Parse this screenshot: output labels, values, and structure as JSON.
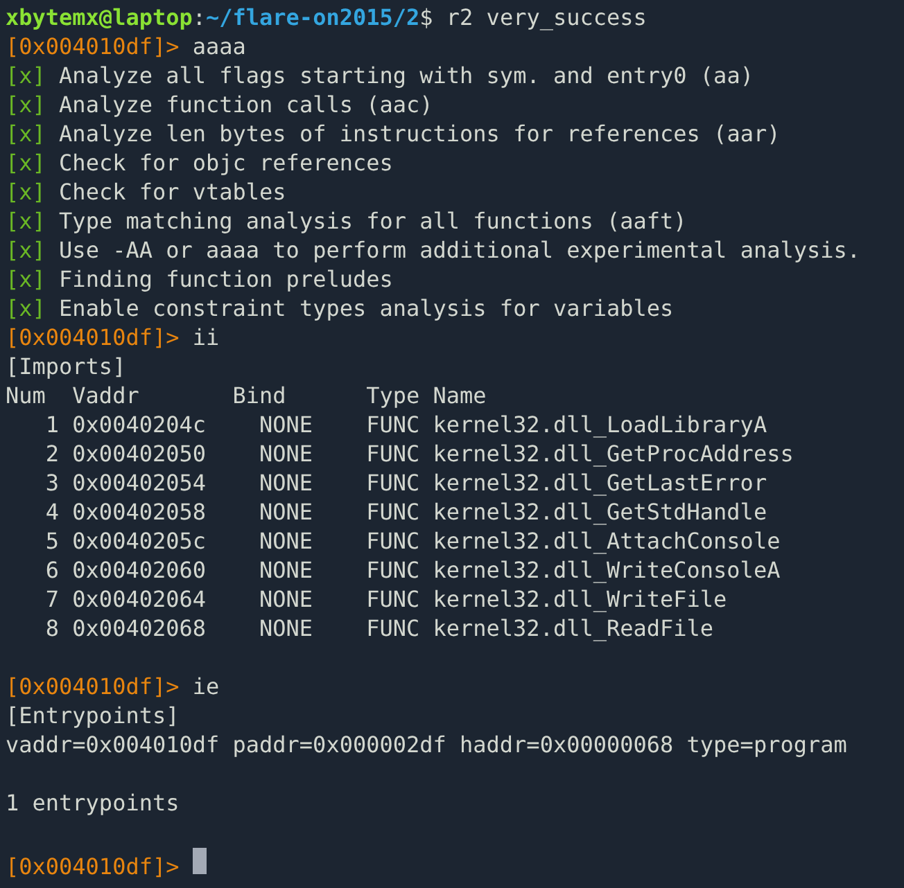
{
  "terminal": {
    "lines": [
      {
        "kind": "shell-prompt",
        "user_host": "xbytemx@laptop",
        "separator": ":",
        "path": "~/flare-on2015/2",
        "symbol": "$",
        "command": "r2 very_success"
      },
      {
        "kind": "r2-prompt",
        "address": "[0x004010df]>",
        "command": "aaaa"
      },
      {
        "kind": "check",
        "mark": "[x]",
        "text": "Analyze all flags starting with sym. and entry0 (aa)"
      },
      {
        "kind": "check",
        "mark": "[x]",
        "text": "Analyze function calls (aac)"
      },
      {
        "kind": "check",
        "mark": "[x]",
        "text": "Analyze len bytes of instructions for references (aar)"
      },
      {
        "kind": "check",
        "mark": "[x]",
        "text": "Check for objc references"
      },
      {
        "kind": "check",
        "mark": "[x]",
        "text": "Check for vtables"
      },
      {
        "kind": "check",
        "mark": "[x]",
        "text": "Type matching analysis for all functions (aaft)"
      },
      {
        "kind": "check",
        "mark": "[x]",
        "text": "Use -AA or aaaa to perform additional experimental analysis."
      },
      {
        "kind": "check",
        "mark": "[x]",
        "text": "Finding function preludes"
      },
      {
        "kind": "check",
        "mark": "[x]",
        "text": "Enable constraint types analysis for variables"
      },
      {
        "kind": "r2-prompt",
        "address": "[0x004010df]>",
        "command": "ii"
      },
      {
        "kind": "output",
        "text": "[Imports]"
      },
      {
        "kind": "output",
        "text": "Num  Vaddr       Bind      Type Name"
      },
      {
        "kind": "output",
        "text": "   1 0x0040204c    NONE    FUNC kernel32.dll_LoadLibraryA"
      },
      {
        "kind": "output",
        "text": "   2 0x00402050    NONE    FUNC kernel32.dll_GetProcAddress"
      },
      {
        "kind": "output",
        "text": "   3 0x00402054    NONE    FUNC kernel32.dll_GetLastError"
      },
      {
        "kind": "output",
        "text": "   4 0x00402058    NONE    FUNC kernel32.dll_GetStdHandle"
      },
      {
        "kind": "output",
        "text": "   5 0x0040205c    NONE    FUNC kernel32.dll_AttachConsole"
      },
      {
        "kind": "output",
        "text": "   6 0x00402060    NONE    FUNC kernel32.dll_WriteConsoleA"
      },
      {
        "kind": "output",
        "text": "   7 0x00402064    NONE    FUNC kernel32.dll_WriteFile"
      },
      {
        "kind": "output",
        "text": "   8 0x00402068    NONE    FUNC kernel32.dll_ReadFile"
      },
      {
        "kind": "blank"
      },
      {
        "kind": "r2-prompt",
        "address": "[0x004010df]>",
        "command": "ie"
      },
      {
        "kind": "output",
        "text": "[Entrypoints]"
      },
      {
        "kind": "output",
        "text": "vaddr=0x004010df paddr=0x000002df haddr=0x00000068 type=program"
      },
      {
        "kind": "blank"
      },
      {
        "kind": "output",
        "text": "1 entrypoints"
      },
      {
        "kind": "blank"
      },
      {
        "kind": "r2-prompt",
        "address": "[0x004010df]>",
        "cursor": true
      }
    ]
  }
}
